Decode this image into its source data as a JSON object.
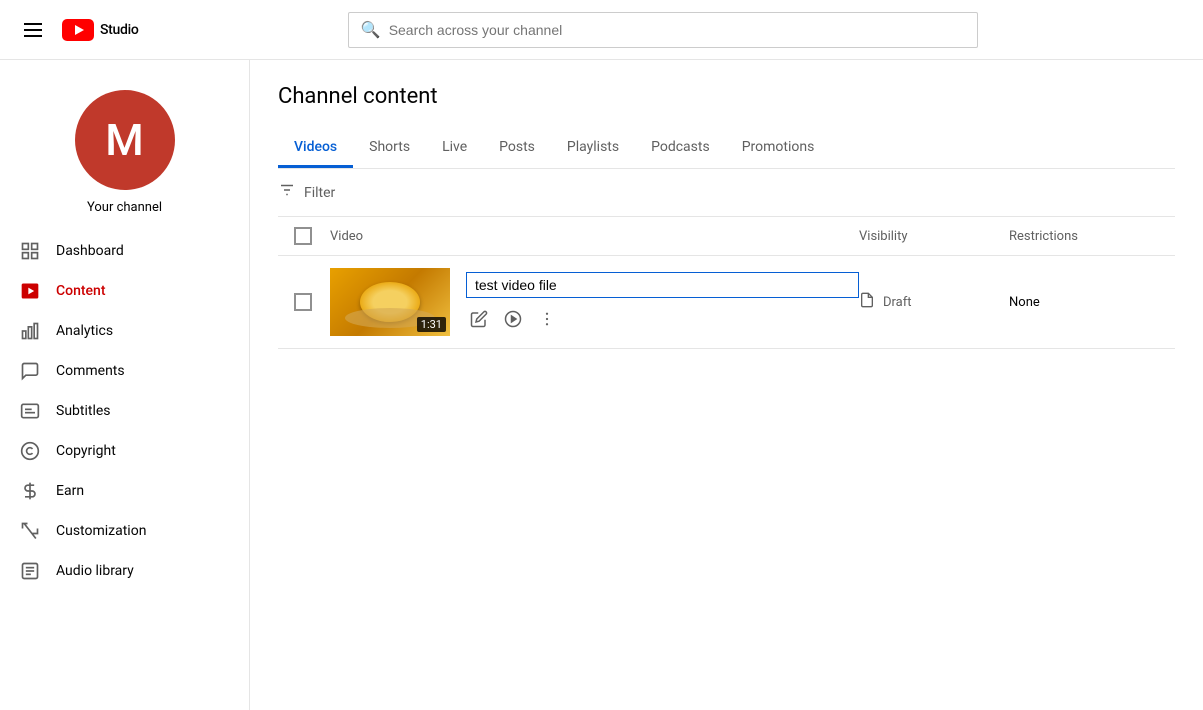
{
  "header": {
    "hamburger_label": "Menu",
    "logo_text": "Studio",
    "search_placeholder": "Search across your channel"
  },
  "sidebar": {
    "avatar_letter": "M",
    "channel_name": "Your channel",
    "nav_items": [
      {
        "id": "dashboard",
        "label": "Dashboard",
        "icon": "grid"
      },
      {
        "id": "content",
        "label": "Content",
        "icon": "play",
        "active": true
      },
      {
        "id": "analytics",
        "label": "Analytics",
        "icon": "bar-chart"
      },
      {
        "id": "comments",
        "label": "Comments",
        "icon": "comment"
      },
      {
        "id": "subtitles",
        "label": "Subtitles",
        "icon": "subtitles"
      },
      {
        "id": "copyright",
        "label": "Copyright",
        "icon": "copyright"
      },
      {
        "id": "earn",
        "label": "Earn",
        "icon": "dollar"
      },
      {
        "id": "customization",
        "label": "Customization",
        "icon": "wand"
      },
      {
        "id": "audio-library",
        "label": "Audio library",
        "icon": "audio"
      }
    ]
  },
  "main": {
    "page_title": "Channel content",
    "tabs": [
      {
        "id": "videos",
        "label": "Videos",
        "active": true
      },
      {
        "id": "shorts",
        "label": "Shorts"
      },
      {
        "id": "live",
        "label": "Live"
      },
      {
        "id": "posts",
        "label": "Posts"
      },
      {
        "id": "playlists",
        "label": "Playlists"
      },
      {
        "id": "podcasts",
        "label": "Podcasts"
      },
      {
        "id": "promotions",
        "label": "Promotions"
      }
    ],
    "filter_label": "Filter",
    "table": {
      "columns": {
        "video": "Video",
        "visibility": "Visibility",
        "restrictions": "Restrictions"
      },
      "rows": [
        {
          "id": "row1",
          "title": "test video file",
          "duration": "1:31",
          "visibility": "Draft",
          "restrictions": "None"
        }
      ]
    }
  }
}
